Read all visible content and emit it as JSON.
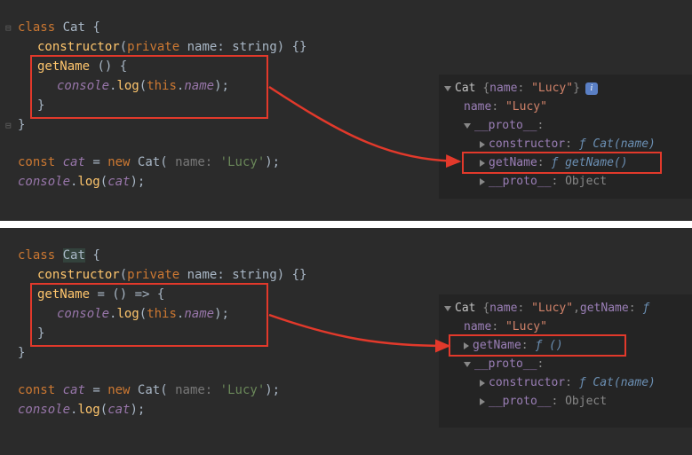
{
  "top": {
    "code": {
      "l1": {
        "kw": "class",
        "name": "Cat",
        "brace": " {"
      },
      "l2": {
        "fn": "constructor",
        "open": "(",
        "mod": "private",
        "pname": "name",
        "colon": ": ",
        "ptype": "string",
        "close": ") {}"
      },
      "l3": {
        "fn": "getName",
        "rest": " () {"
      },
      "l4a": "console",
      "l4b": ".",
      "l4c": "log",
      "l4d": "(",
      "l4e": "this",
      "l4f": ".",
      "l4g": "name",
      "l4h": ");",
      "l5": "}",
      "l6": "}",
      "l7a": "const",
      "l7b": "cat",
      "l7c": " = ",
      "l7d": "new",
      "l7e": "Cat",
      "l7f": "(",
      "l7g": " name: ",
      "l7h": "'Lucy'",
      "l7i": ");",
      "l8a": "console",
      "l8b": ".",
      "l8c": "log",
      "l8d": "(",
      "l8e": "cat",
      "l8f": ");"
    },
    "console": {
      "row1": {
        "cls": "Cat",
        "open": "{",
        "k1": "name",
        "v1": "\"Lucy\"",
        "close": "}"
      },
      "row2": {
        "k": "name",
        "v": "\"Lucy\""
      },
      "row3": {
        "k": "__proto__",
        "colon": ":"
      },
      "row4": {
        "k": "constructor",
        "fkw": "ƒ",
        "sig": "Cat(name)"
      },
      "row5": {
        "k": "getName",
        "fkw": "ƒ",
        "sig": "getName()"
      },
      "row6": {
        "k": "__proto__",
        "v": "Object"
      }
    }
  },
  "bottom": {
    "code": {
      "l1": {
        "kw": "class",
        "name": "Cat",
        "brace": " {"
      },
      "l2": {
        "fn": "constructor",
        "open": "(",
        "mod": "private",
        "pname": "name",
        "colon": ": ",
        "ptype": "string",
        "close": ") {}"
      },
      "l3a": "getName",
      "l3b": " = () => {",
      "l4a": "console",
      "l4b": ".",
      "l4c": "log",
      "l4d": "(",
      "l4e": "this",
      "l4f": ".",
      "l4g": "name",
      "l4h": ");",
      "l5": "}",
      "l6": "}",
      "l7a": "const",
      "l7b": "cat",
      "l7c": " = ",
      "l7d": "new",
      "l7e": "Cat",
      "l7f": "(",
      "l7g": " name: ",
      "l7h": "'Lucy'",
      "l7i": ");",
      "l8a": "console",
      "l8b": ".",
      "l8c": "log",
      "l8d": "(",
      "l8e": "cat",
      "l8f": ");"
    },
    "console": {
      "row1": {
        "cls": "Cat",
        "open": "{",
        "k1": "name",
        "v1": "\"Lucy\"",
        "sep": ", ",
        "k2": "getName",
        "fkw": "ƒ"
      },
      "row2": {
        "k": "name",
        "v": "\"Lucy\""
      },
      "row3": {
        "k": "getName",
        "fkw": "ƒ",
        "sig": "()"
      },
      "row4": {
        "k": "__proto__",
        "colon": ":"
      },
      "row5": {
        "k": "constructor",
        "fkw": "ƒ",
        "sig": "Cat(name)"
      },
      "row6": {
        "k": "__proto__",
        "v": "Object"
      }
    }
  }
}
